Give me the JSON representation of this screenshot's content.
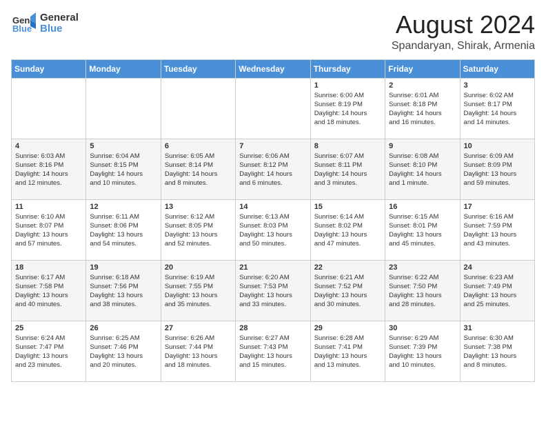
{
  "header": {
    "logo_general": "General",
    "logo_blue": "Blue",
    "month_year": "August 2024",
    "location": "Spandaryan, Shirak, Armenia"
  },
  "days_of_week": [
    "Sunday",
    "Monday",
    "Tuesday",
    "Wednesday",
    "Thursday",
    "Friday",
    "Saturday"
  ],
  "weeks": [
    [
      {
        "day": "",
        "info": ""
      },
      {
        "day": "",
        "info": ""
      },
      {
        "day": "",
        "info": ""
      },
      {
        "day": "",
        "info": ""
      },
      {
        "day": "1",
        "info": "Sunrise: 6:00 AM\nSunset: 8:19 PM\nDaylight: 14 hours\nand 18 minutes."
      },
      {
        "day": "2",
        "info": "Sunrise: 6:01 AM\nSunset: 8:18 PM\nDaylight: 14 hours\nand 16 minutes."
      },
      {
        "day": "3",
        "info": "Sunrise: 6:02 AM\nSunset: 8:17 PM\nDaylight: 14 hours\nand 14 minutes."
      }
    ],
    [
      {
        "day": "4",
        "info": "Sunrise: 6:03 AM\nSunset: 8:16 PM\nDaylight: 14 hours\nand 12 minutes."
      },
      {
        "day": "5",
        "info": "Sunrise: 6:04 AM\nSunset: 8:15 PM\nDaylight: 14 hours\nand 10 minutes."
      },
      {
        "day": "6",
        "info": "Sunrise: 6:05 AM\nSunset: 8:14 PM\nDaylight: 14 hours\nand 8 minutes."
      },
      {
        "day": "7",
        "info": "Sunrise: 6:06 AM\nSunset: 8:12 PM\nDaylight: 14 hours\nand 6 minutes."
      },
      {
        "day": "8",
        "info": "Sunrise: 6:07 AM\nSunset: 8:11 PM\nDaylight: 14 hours\nand 3 minutes."
      },
      {
        "day": "9",
        "info": "Sunrise: 6:08 AM\nSunset: 8:10 PM\nDaylight: 14 hours\nand 1 minute."
      },
      {
        "day": "10",
        "info": "Sunrise: 6:09 AM\nSunset: 8:09 PM\nDaylight: 13 hours\nand 59 minutes."
      }
    ],
    [
      {
        "day": "11",
        "info": "Sunrise: 6:10 AM\nSunset: 8:07 PM\nDaylight: 13 hours\nand 57 minutes."
      },
      {
        "day": "12",
        "info": "Sunrise: 6:11 AM\nSunset: 8:06 PM\nDaylight: 13 hours\nand 54 minutes."
      },
      {
        "day": "13",
        "info": "Sunrise: 6:12 AM\nSunset: 8:05 PM\nDaylight: 13 hours\nand 52 minutes."
      },
      {
        "day": "14",
        "info": "Sunrise: 6:13 AM\nSunset: 8:03 PM\nDaylight: 13 hours\nand 50 minutes."
      },
      {
        "day": "15",
        "info": "Sunrise: 6:14 AM\nSunset: 8:02 PM\nDaylight: 13 hours\nand 47 minutes."
      },
      {
        "day": "16",
        "info": "Sunrise: 6:15 AM\nSunset: 8:01 PM\nDaylight: 13 hours\nand 45 minutes."
      },
      {
        "day": "17",
        "info": "Sunrise: 6:16 AM\nSunset: 7:59 PM\nDaylight: 13 hours\nand 43 minutes."
      }
    ],
    [
      {
        "day": "18",
        "info": "Sunrise: 6:17 AM\nSunset: 7:58 PM\nDaylight: 13 hours\nand 40 minutes."
      },
      {
        "day": "19",
        "info": "Sunrise: 6:18 AM\nSunset: 7:56 PM\nDaylight: 13 hours\nand 38 minutes."
      },
      {
        "day": "20",
        "info": "Sunrise: 6:19 AM\nSunset: 7:55 PM\nDaylight: 13 hours\nand 35 minutes."
      },
      {
        "day": "21",
        "info": "Sunrise: 6:20 AM\nSunset: 7:53 PM\nDaylight: 13 hours\nand 33 minutes."
      },
      {
        "day": "22",
        "info": "Sunrise: 6:21 AM\nSunset: 7:52 PM\nDaylight: 13 hours\nand 30 minutes."
      },
      {
        "day": "23",
        "info": "Sunrise: 6:22 AM\nSunset: 7:50 PM\nDaylight: 13 hours\nand 28 minutes."
      },
      {
        "day": "24",
        "info": "Sunrise: 6:23 AM\nSunset: 7:49 PM\nDaylight: 13 hours\nand 25 minutes."
      }
    ],
    [
      {
        "day": "25",
        "info": "Sunrise: 6:24 AM\nSunset: 7:47 PM\nDaylight: 13 hours\nand 23 minutes."
      },
      {
        "day": "26",
        "info": "Sunrise: 6:25 AM\nSunset: 7:46 PM\nDaylight: 13 hours\nand 20 minutes."
      },
      {
        "day": "27",
        "info": "Sunrise: 6:26 AM\nSunset: 7:44 PM\nDaylight: 13 hours\nand 18 minutes."
      },
      {
        "day": "28",
        "info": "Sunrise: 6:27 AM\nSunset: 7:43 PM\nDaylight: 13 hours\nand 15 minutes."
      },
      {
        "day": "29",
        "info": "Sunrise: 6:28 AM\nSunset: 7:41 PM\nDaylight: 13 hours\nand 13 minutes."
      },
      {
        "day": "30",
        "info": "Sunrise: 6:29 AM\nSunset: 7:39 PM\nDaylight: 13 hours\nand 10 minutes."
      },
      {
        "day": "31",
        "info": "Sunrise: 6:30 AM\nSunset: 7:38 PM\nDaylight: 13 hours\nand 8 minutes."
      }
    ]
  ]
}
